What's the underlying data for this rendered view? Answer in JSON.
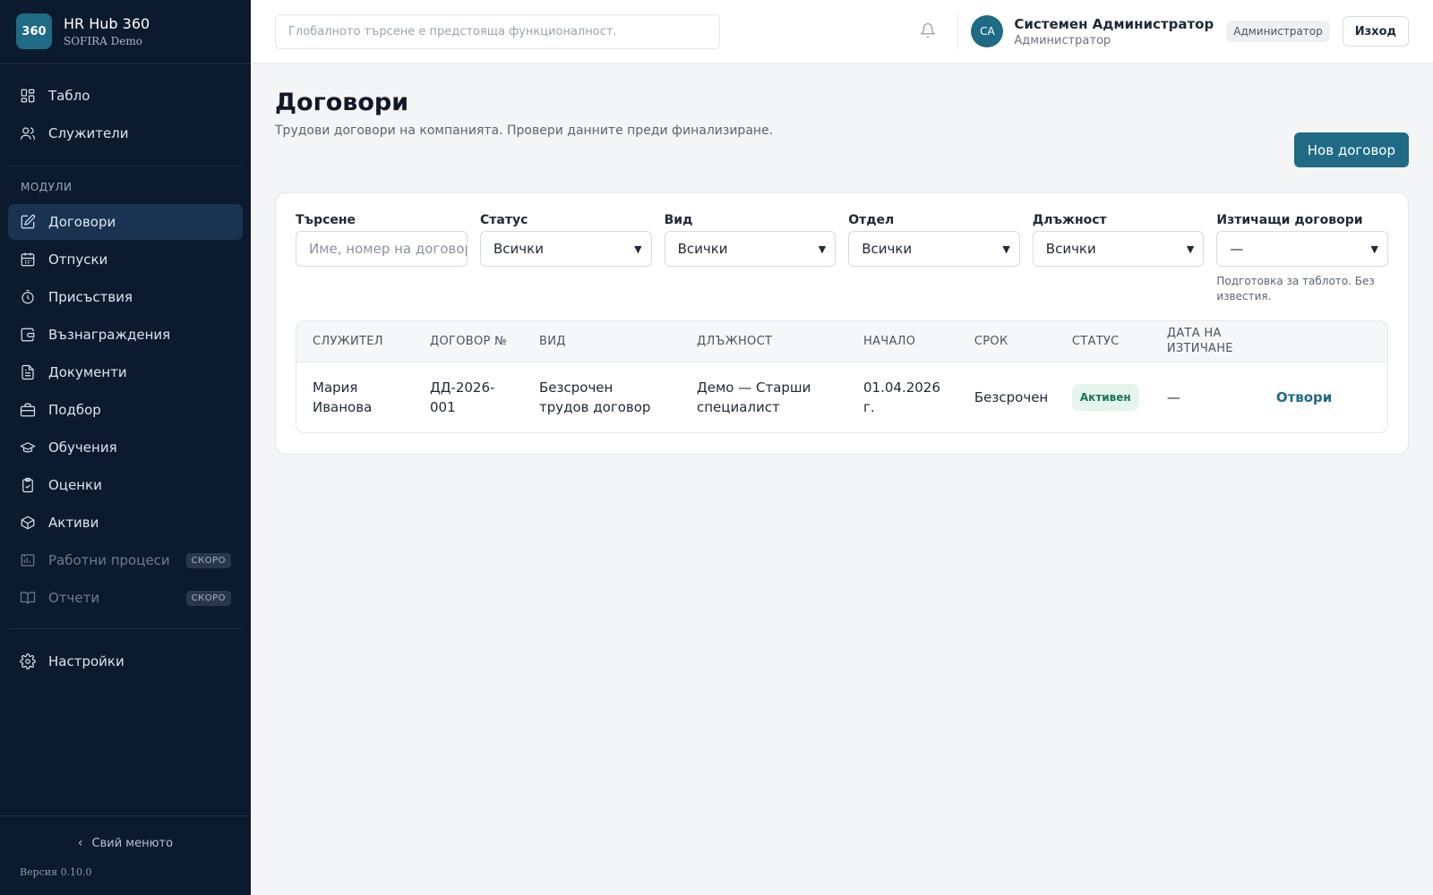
{
  "brand": {
    "logo": "360",
    "name": "HR Hub 360",
    "sub": "SOFIRA Demo"
  },
  "nav": {
    "top": [
      {
        "label": "Табло",
        "icon": "dashboard-icon"
      },
      {
        "label": "Служители",
        "icon": "users-icon"
      }
    ],
    "modules_label": "Модули",
    "modules": [
      {
        "label": "Договори",
        "icon": "contract-edit-icon",
        "active": true
      },
      {
        "label": "Отпуски",
        "icon": "calendar-icon"
      },
      {
        "label": "Присъствия",
        "icon": "stopwatch-icon"
      },
      {
        "label": "Възнаграждения",
        "icon": "wallet-icon"
      },
      {
        "label": "Документи",
        "icon": "document-icon"
      },
      {
        "label": "Подбор",
        "icon": "briefcase-icon"
      },
      {
        "label": "Обучения",
        "icon": "graduation-cap-icon"
      },
      {
        "label": "Оценки",
        "icon": "clipboard-check-icon"
      },
      {
        "label": "Активи",
        "icon": "package-icon"
      },
      {
        "label": "Работни процеси",
        "icon": "workflow-icon",
        "badge": "СКОРО",
        "disabled": true
      },
      {
        "label": "Отчети",
        "icon": "book-icon",
        "badge": "СКОРО",
        "disabled": true
      }
    ],
    "bottom": [
      {
        "label": "Настройки",
        "icon": "gear-icon"
      }
    ],
    "collapse_label": "Свий менюто",
    "version": "Версия 0.10.0"
  },
  "topbar": {
    "search_placeholder": "Глобалното търсене е предстояща функционалност.",
    "avatar": "СА",
    "user_name": "Системен Администратор",
    "user_role": "Администратор",
    "role_badge": "Администратор",
    "logout": "Изход"
  },
  "page": {
    "title": "Договори",
    "subtitle": "Трудови договори на компанията. Провери данните преди финализиране.",
    "new_button": "Нов договор"
  },
  "filters": {
    "search": {
      "label": "Търсене",
      "placeholder": "Име, номер на договор"
    },
    "status": {
      "label": "Статус",
      "value": "Всички"
    },
    "type": {
      "label": "Вид",
      "value": "Всички"
    },
    "department": {
      "label": "Отдел",
      "value": "Всички"
    },
    "position": {
      "label": "Длъжност",
      "value": "Всички"
    },
    "expiring": {
      "label": "Изтичащи договори",
      "value": "—",
      "hint": "Подготовка за таблото. Без известия."
    }
  },
  "table": {
    "headers": [
      "Служител",
      "Договор №",
      "Вид",
      "Длъжност",
      "Начало",
      "Срок",
      "Статус",
      "Дата на изтичане",
      ""
    ],
    "rows": [
      {
        "employee": "Мария Иванова",
        "number": "ДД-2026-001",
        "type": "Безсрочен трудов договор",
        "position": "Демо — Старши специалист",
        "start": "01.04.2026 г.",
        "term": "Безсрочен",
        "status": "Активен",
        "expiry": "—",
        "action": "Отвори"
      }
    ]
  }
}
